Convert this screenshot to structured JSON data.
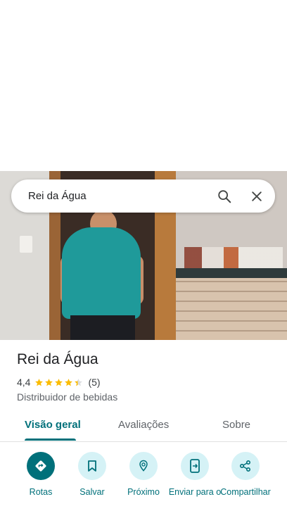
{
  "search": {
    "query": "Rei da Água",
    "search_icon": "search-icon",
    "close_icon": "close-icon"
  },
  "place": {
    "name": "Rei da Água",
    "rating": "4,4",
    "rating_value": 4.4,
    "review_count": "(5)",
    "category": "Distribuidor de bebidas"
  },
  "tabs": [
    {
      "label": "Visão geral",
      "active": true
    },
    {
      "label": "Avaliações",
      "active": false
    },
    {
      "label": "Sobre",
      "active": false
    }
  ],
  "actions": [
    {
      "label": "Rotas",
      "icon": "directions-icon"
    },
    {
      "label": "Salvar",
      "icon": "bookmark-icon"
    },
    {
      "label": "Próximo",
      "icon": "nearby-icon"
    },
    {
      "label": "Enviar para o",
      "icon": "send-to-phone-icon"
    },
    {
      "label": "Compartilhar",
      "icon": "share-icon"
    }
  ],
  "colors": {
    "accent": "#00707a",
    "accent_light": "#d5f2f6",
    "star": "#fbbc04"
  }
}
